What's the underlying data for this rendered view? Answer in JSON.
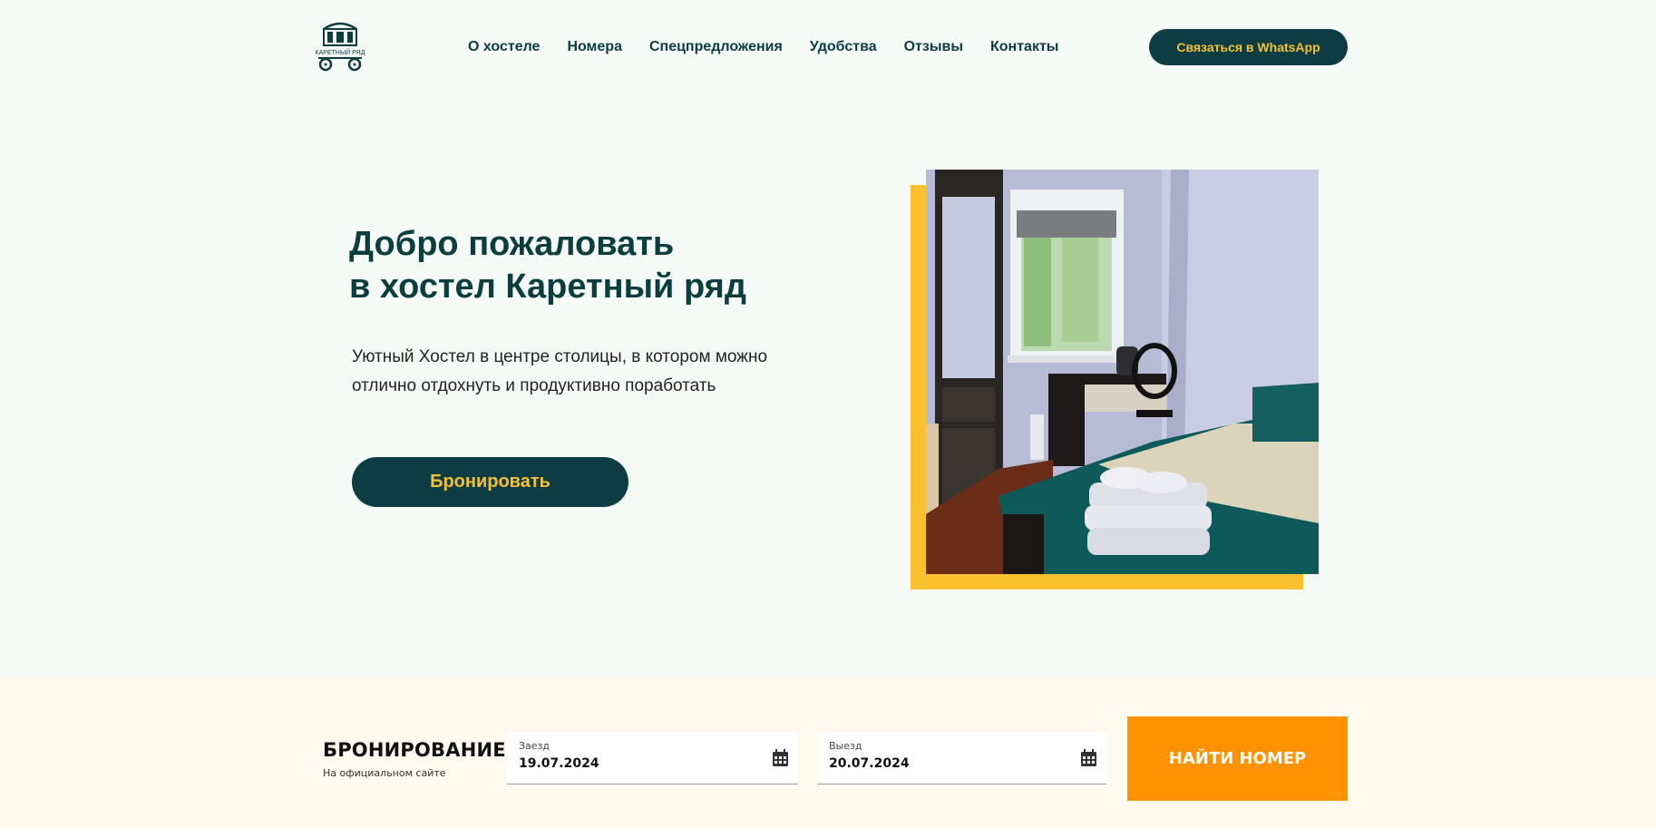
{
  "header": {
    "logo_text": "КАРЕТНЫЙ РЯД",
    "nav": [
      {
        "label": "О хостеле"
      },
      {
        "label": "Номера"
      },
      {
        "label": "Спецпредложения"
      },
      {
        "label": "Удобства"
      },
      {
        "label": "Отзывы"
      },
      {
        "label": "Контакты"
      }
    ],
    "contact_button": "Связаться в WhatsApp"
  },
  "hero": {
    "title_line1": "Добро пожаловать",
    "title_line2": "в хостел Каретный ряд",
    "subtitle_line1": "Уютный Хостел в центре столицы, в котором можно",
    "subtitle_line2": "отлично отдохнуть и продуктивно поработать",
    "book_button": "Бронировать"
  },
  "booking": {
    "title": "БРОНИРОВАНИЕ",
    "subtitle": "На официальном сайте",
    "checkin_label": "Заезд",
    "checkin_value": "19.07.2024",
    "checkout_label": "Выезд",
    "checkout_value": "20.07.2024",
    "find_button": "НАЙТИ НОМЕР"
  },
  "colors": {
    "primary": "#0d3d42",
    "accent_yellow": "#f5bf36",
    "accent_orange": "#fe9200",
    "background": "#f6faf7"
  },
  "icons": {
    "date_picker": "calendar-icon"
  }
}
